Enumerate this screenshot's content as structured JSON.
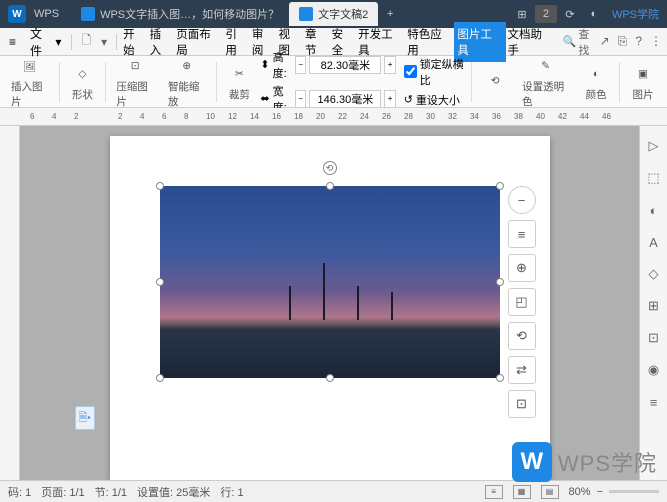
{
  "titlebar": {
    "app_logo": "W",
    "app_name": "WPS",
    "tab1": "WPS文字插入图…，如何移动图片？",
    "tab2": "文字文稿2",
    "badge_num": "2",
    "wps_academy": "WPS学院"
  },
  "menubar": {
    "menu_icon": "≡",
    "file": "文件",
    "tabs": {
      "start": "开始",
      "insert": "插入",
      "layout": "页面布局",
      "reference": "引用",
      "review": "审阅",
      "view": "视图",
      "chapter": "章节",
      "security": "安全",
      "dev": "开发工具",
      "special": "特色应用",
      "picture_tools": "图片工具",
      "doc_helper": "文档助手"
    },
    "search": "查找"
  },
  "ribbon": {
    "insert_pic": "插入图片",
    "shapes": "形状",
    "compress": "压缩图片",
    "smart_zoom": "智能缩放",
    "crop": "裁剪",
    "height_label": "高度:",
    "height_value": "82.30毫米",
    "width_label": "宽度:",
    "width_value": "146.30毫米",
    "lock_ratio": "锁定纵横比",
    "reset_size": "重设大小",
    "set_transparent": "设置透明色",
    "color": "颜色",
    "pic": "图片"
  },
  "ruler": {
    "marks": [
      "6",
      "4",
      "2",
      "",
      "2",
      "4",
      "6",
      "8",
      "10",
      "12",
      "14",
      "16",
      "18",
      "20",
      "22",
      "24",
      "26",
      "28",
      "30",
      "32",
      "34",
      "36",
      "38",
      "40",
      "42",
      "44",
      "46"
    ]
  },
  "statusbar": {
    "page_num": "码: 1",
    "page": "页面: 1/1",
    "section": "节: 1/1",
    "position": "设置值: 25毫米",
    "line": "行: 1",
    "zoom": "80%",
    "zoom_minus": "−",
    "zoom_plus": "+"
  },
  "watermark": {
    "logo": "W",
    "text": "WPS学院"
  },
  "float_tools": {
    "minus": "−",
    "layout": "≡",
    "zoom": "⊕",
    "crop": "◰",
    "rotate": "⟲",
    "replace": "⇄",
    "more": "⊡"
  },
  "side_tools": [
    "▷",
    "⬚",
    "◐",
    "A",
    "◇",
    "⊞",
    "⊡",
    "◉",
    "≡"
  ]
}
